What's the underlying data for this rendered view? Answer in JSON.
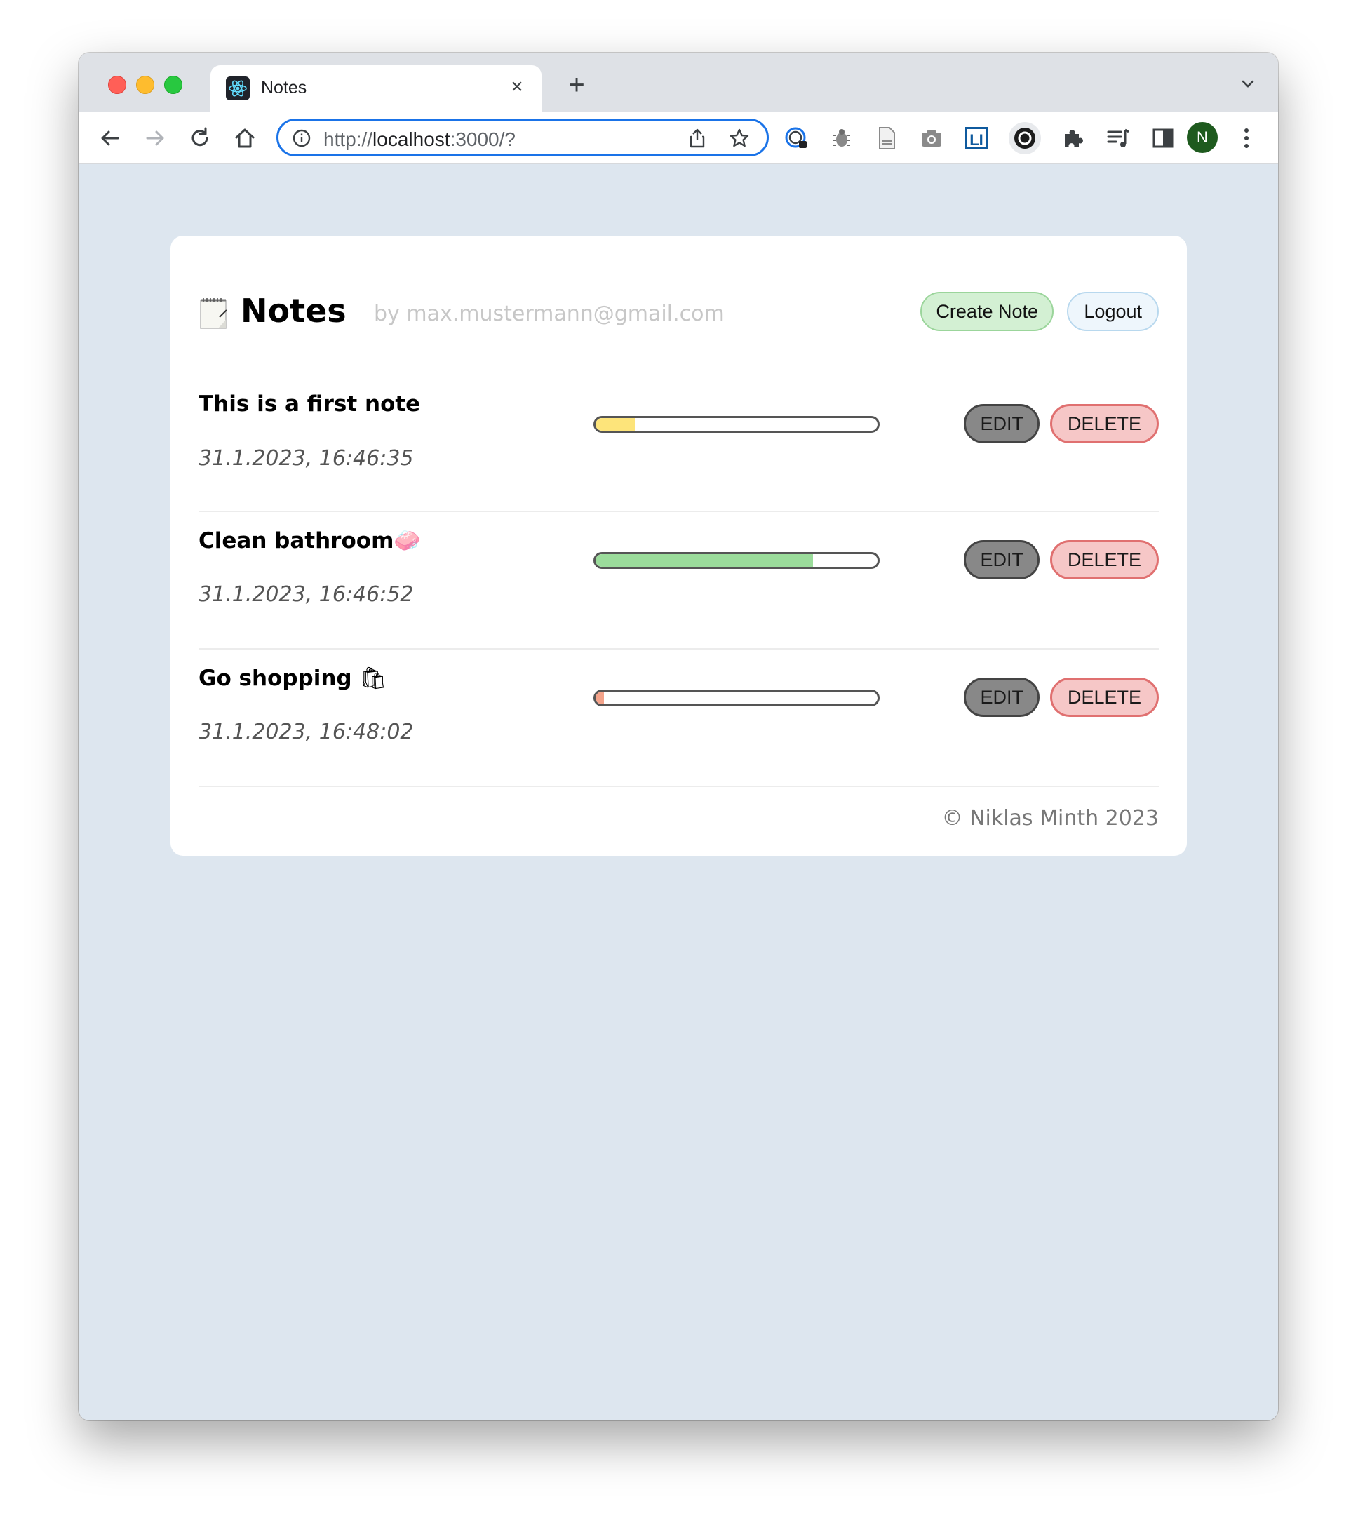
{
  "browser": {
    "tab_title": "Notes",
    "url_scheme": "http://",
    "url_host": "localhost",
    "url_rest": ":3000/?",
    "profile_initial": "N",
    "accent_color": "#1a73e8"
  },
  "app": {
    "title": "Notes",
    "by_line": "by max.mustermann@gmail.com",
    "create_note_label": "Create Note",
    "logout_label": "Logout",
    "footer": "© Niklas Minth 2023"
  },
  "notes": [
    {
      "title": "This is a first note",
      "emoji": "",
      "date": "31.1.2023, 16:46:35",
      "progress": 0.14,
      "progress_color": "#fde47a",
      "edit_label": "EDIT",
      "delete_label": "DELETE"
    },
    {
      "title": "Clean bathroom",
      "emoji": "🧼",
      "date": "31.1.2023, 16:46:52",
      "progress": 0.77,
      "progress_color": "#9bdc9b",
      "edit_label": "EDIT",
      "delete_label": "DELETE"
    },
    {
      "title": "Go shopping ",
      "emoji": "🛍",
      "date": "31.1.2023, 16:48:02",
      "progress": 0.03,
      "progress_color": "#f4a38a",
      "edit_label": "EDIT",
      "delete_label": "DELETE"
    }
  ]
}
